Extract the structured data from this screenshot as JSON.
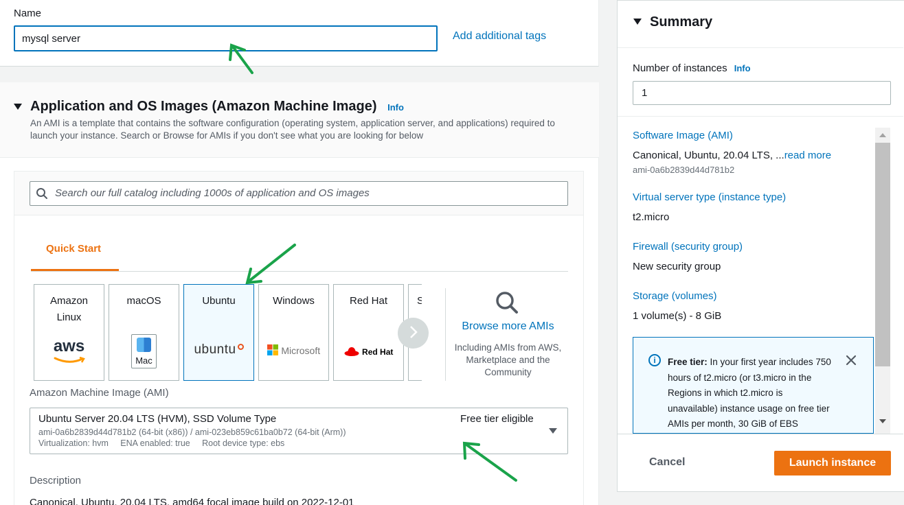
{
  "name_section": {
    "label": "Name",
    "value": "mysql server",
    "add_tags": "Add additional tags"
  },
  "ami_section": {
    "title": "Application and OS Images (Amazon Machine Image)",
    "info": "Info",
    "description": "An AMI is a template that contains the software configuration (operating system, application server, and applications) required to launch your instance. Search or Browse for AMIs if you don't see what you are looking for below",
    "search_placeholder": "Search our full catalog including 1000s of application and OS images",
    "tab_quick_start": "Quick Start",
    "os_cards": [
      {
        "label": "Amazon Linux",
        "logo": "aws",
        "icon": "aws-logo-icon"
      },
      {
        "label": "macOS",
        "logo": "Mac",
        "icon": "mac-finder-icon"
      },
      {
        "label": "Ubuntu",
        "logo": "ubuntu",
        "icon": "ubuntu-logo-icon",
        "selected": true
      },
      {
        "label": "Windows",
        "logo": "Microsoft",
        "icon": "microsoft-logo-icon"
      },
      {
        "label": "Red Hat",
        "logo": "Red Hat",
        "icon": "redhat-logo-icon"
      },
      {
        "label": "S",
        "logo": "",
        "icon": ""
      }
    ],
    "browse_more": "Browse more AMIs",
    "browse_sub": "Including AMIs from AWS, Marketplace and the Community",
    "ami_label": "Amazon Machine Image (AMI)",
    "ami_name": "Ubuntu Server 20.04 LTS (HVM), SSD Volume Type",
    "ami_free": "Free tier eligible",
    "ami_ids": "ami-0a6b2839d44d781b2 (64-bit (x86)) / ami-023eb859c61ba0b72 (64-bit (Arm))",
    "ami_meta": "Virtualization: hvm     ENA enabled: true     Root device type: ebs",
    "description_label": "Description",
    "description_text": "Canonical, Ubuntu, 20.04 LTS, amd64 focal image build on 2022-12-01"
  },
  "summary": {
    "title": "Summary",
    "instances_label": "Number of instances",
    "instances_info": "Info",
    "instances_value": "1",
    "software_image_label": "Software Image (AMI)",
    "software_image_value": "Canonical, Ubuntu, 20.04 LTS, ...",
    "read_more": "read more",
    "software_image_id": "ami-0a6b2839d44d781b2",
    "server_type_label": "Virtual server type (instance type)",
    "server_type_value": "t2.micro",
    "firewall_label": "Firewall (security group)",
    "firewall_value": "New security group",
    "storage_label": "Storage (volumes)",
    "storage_value": "1 volume(s) - 8 GiB",
    "free_tier_title": "Free tier:",
    "free_tier_text": "In your first year includes 750 hours of t2.micro (or t3.micro in the Regions in which t2.micro is unavailable) instance usage on free tier AMIs per month, 30 GiB of EBS",
    "cancel": "Cancel",
    "launch": "Launch instance"
  },
  "colors": {
    "accent": "#0073bb",
    "primary_button": "#ec7211",
    "annotation_arrow": "#1aa34a"
  }
}
